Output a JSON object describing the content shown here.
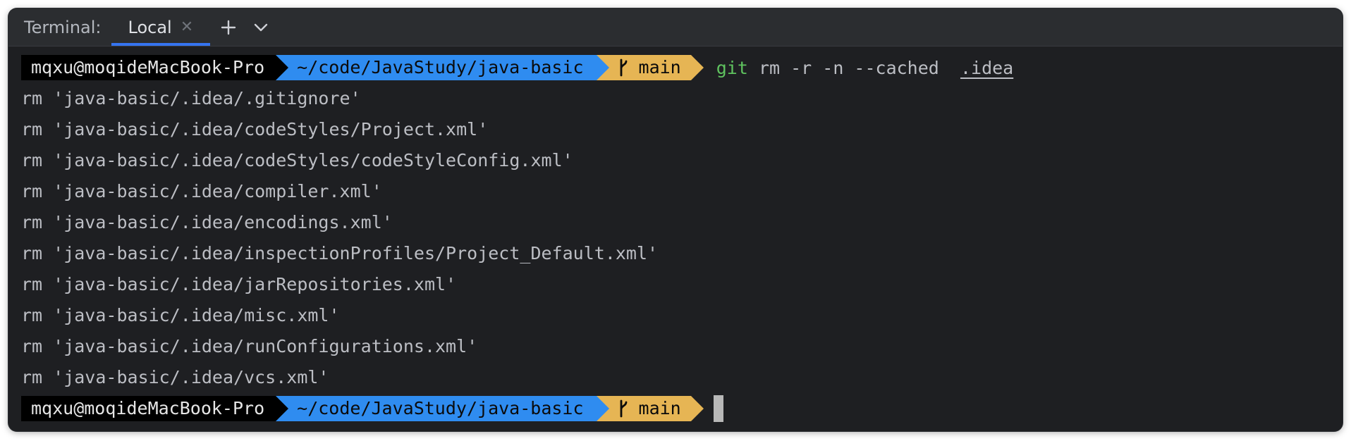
{
  "toolwindow": {
    "title": "Terminal:",
    "tabs": [
      {
        "label": "Local",
        "close_icon": "close-icon"
      }
    ],
    "add_icon": "plus-icon",
    "dropdown_icon": "chevron-down-icon"
  },
  "prompt": {
    "user_host": "mqxu@moqideMacBook-Pro",
    "path": "~/code/JavaStudy/java-basic",
    "branch": "main",
    "branch_icon": "git-branch-icon"
  },
  "command": {
    "program": "git",
    "args": "rm -r -n --cached ",
    "target": ".idea"
  },
  "output_lines": [
    "rm 'java-basic/.idea/.gitignore'",
    "rm 'java-basic/.idea/codeStyles/Project.xml'",
    "rm 'java-basic/.idea/codeStyles/codeStyleConfig.xml'",
    "rm 'java-basic/.idea/compiler.xml'",
    "rm 'java-basic/.idea/encodings.xml'",
    "rm 'java-basic/.idea/inspectionProfiles/Project_Default.xml'",
    "rm 'java-basic/.idea/jarRepositories.xml'",
    "rm 'java-basic/.idea/misc.xml'",
    "rm 'java-basic/.idea/runConfigurations.xml'",
    "rm 'java-basic/.idea/vcs.xml'"
  ],
  "colors": {
    "background": "#1e1f22",
    "tabbar": "#2b2d30",
    "tab_underline": "#3574f0",
    "segment_user": "#000000",
    "segment_path": "#2f8cf0",
    "segment_branch": "#e6b554",
    "git_command": "#5fc35f",
    "text": "#bcbec4"
  }
}
